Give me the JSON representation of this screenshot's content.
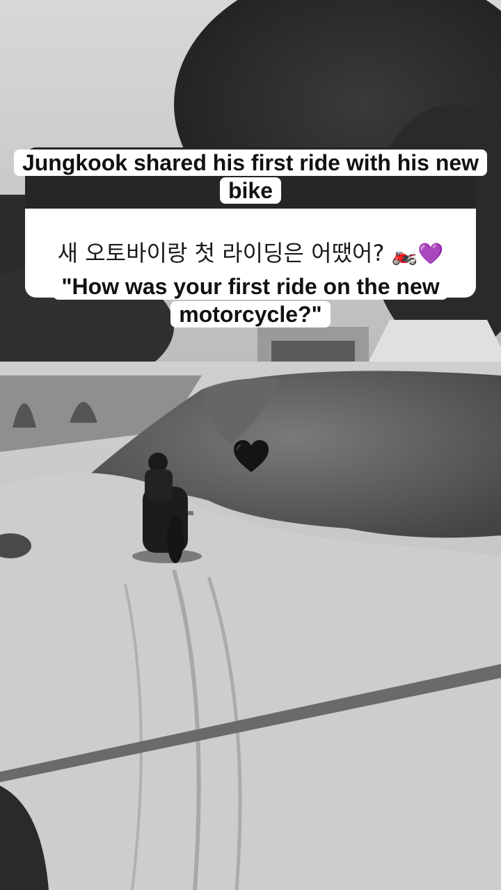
{
  "caption": {
    "title": "Jungkook shared his first ride with his new bike",
    "korean": "새 오토바이랑 첫 라이딩은 어땠어?",
    "korean_emojis": "🏍️💜",
    "translation": "\"How was your first ride on the new motorcycle?\""
  },
  "overlay": {
    "heart_icon": "black-heart-emoji"
  },
  "colors": {
    "caption_dark": "#262626",
    "caption_light": "#ffffff",
    "text": "#111111"
  }
}
